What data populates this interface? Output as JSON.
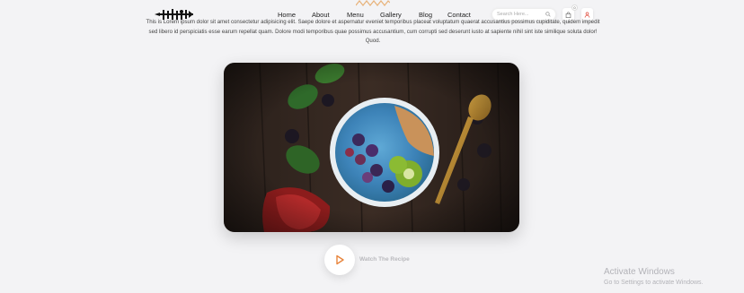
{
  "header": {
    "logo_name": "fork-knife-logo",
    "nav": [
      {
        "label": "Home"
      },
      {
        "label": "About"
      },
      {
        "label": "Menu"
      },
      {
        "label": "Gallery"
      },
      {
        "label": "Blog"
      },
      {
        "label": "Contact"
      }
    ],
    "search": {
      "placeholder": "Search Here..."
    },
    "cart_count": "0"
  },
  "intro": {
    "text": "This is Lorem ipsum dolor sit amet consectetur adipisicing elit. Saepe dolore et aspernatur eveniet temporibus placeat voluptatum quaerat accusantius possimus cupiditate, quidem impedit sed libero id perspiciatis esse earum repellat quam. Dolore modi temporibus quae possimus accusantium, cum corrupti sed deserunt iusto at sapiente nihil sint iste similique soluta dolor! Quod."
  },
  "hero": {
    "alt": "smoothie bowl with berries, kiwi, granola, spinach, pomegranate and a gold spoon"
  },
  "watch": {
    "label": "Watch The Recipe"
  },
  "watermark": {
    "title": "Activate Windows",
    "subtitle": "Go to Settings to activate Windows."
  },
  "colors": {
    "accent": "#e8853d",
    "background": "#f3f3f5"
  }
}
